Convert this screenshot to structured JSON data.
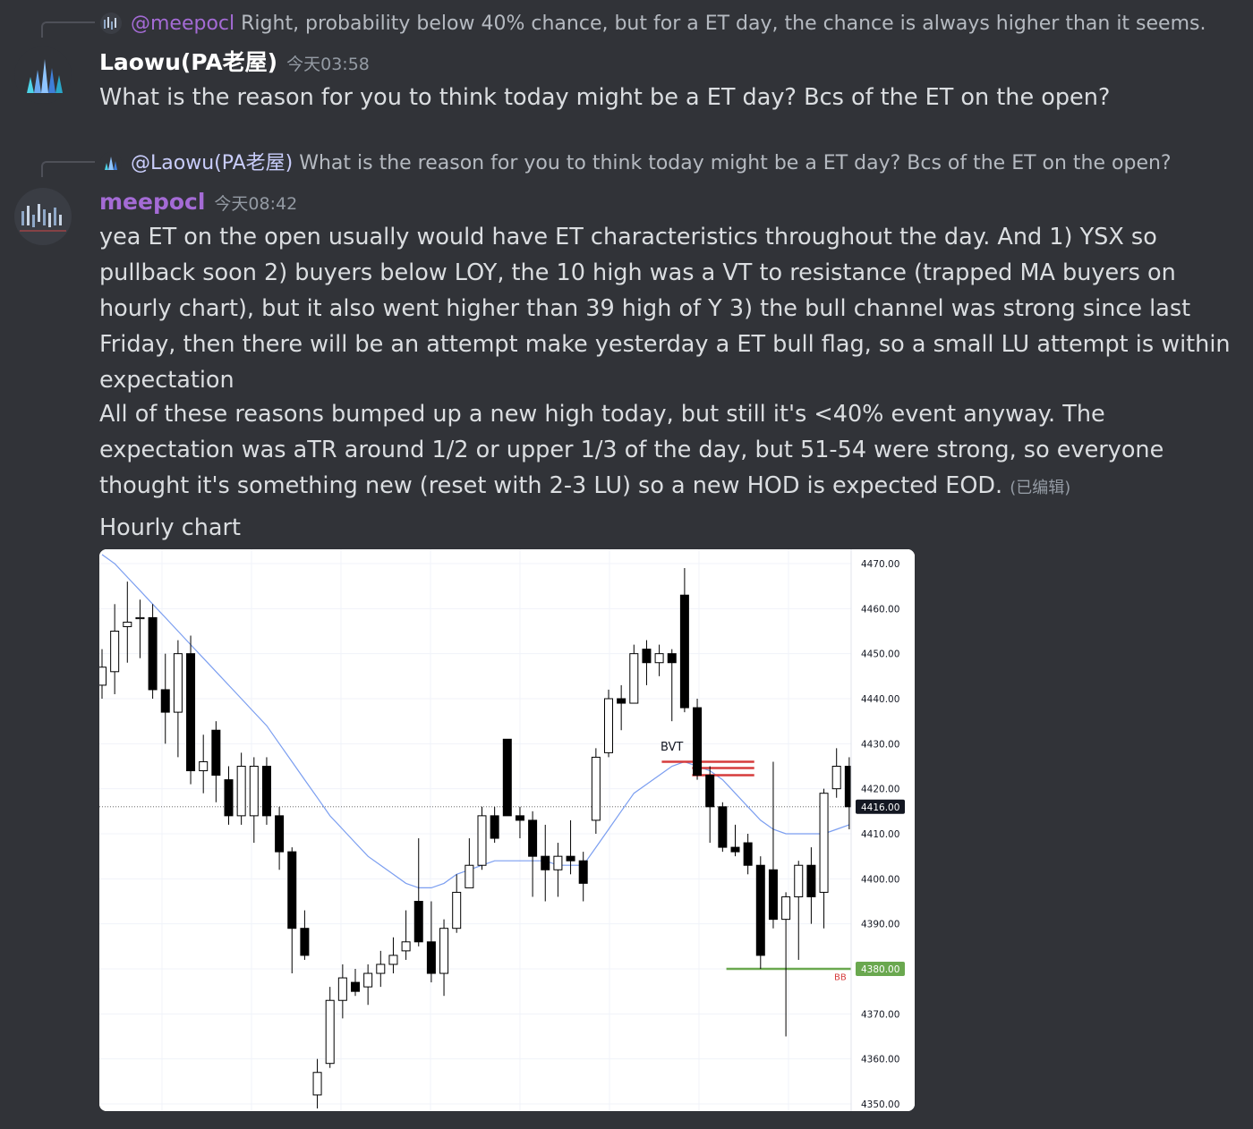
{
  "messages": [
    {
      "reply": {
        "mention": "@meepocl",
        "text": "Right, probability below 40% chance, but for a ET day, the chance is always higher than it seems."
      },
      "author": "Laowu(PA老屋)",
      "timestamp": "今天03:58",
      "content": "What is the reason for you to think today might be a ET day? Bcs of the ET on the open?"
    },
    {
      "reply": {
        "mention": "@Laowu(PA老屋)",
        "text": "What is the reason for you to think today might be a ET day? Bcs of the ET on the open?"
      },
      "author": "meepocl",
      "timestamp": "今天08:42",
      "paragraph1": "yea ET on the open usually would have ET characteristics throughout the day. And 1) YSX so pullback soon 2) buyers below LOY, the 10 high was a VT to resistance (trapped MA buyers on hourly chart),  but it also went higher than 39 high of Y 3) the bull channel was strong since last Friday, then there will be an attempt make yesterday a ET bull flag, so a small LU attempt is within expectation",
      "paragraph2": "All of these reasons bumped up a new high today, but still it's <40% event anyway. The expectation was aTR around 1/2 or upper 1/3 of the day, but 51-54 were strong, so everyone thought it's something new (reset with 2-3 LU) so a new HOD is expected EOD.",
      "edited": "(已编辑)",
      "attachment_title": "Hourly chart"
    }
  ],
  "colors": {
    "laowu_name": "#ffffff",
    "meepocl_name": "#a46bd5",
    "meepocl_mention": "#b98ce6",
    "laowu_mention": "#c9cdfb",
    "ma_line": "#7b9ef0",
    "resistance": "#d63c3c",
    "support": "#6aa84f"
  },
  "chart_data": {
    "type": "candlestick",
    "timeframe": "hourly",
    "y_ticks": [
      "4470.00",
      "4460.00",
      "4450.00",
      "4440.00",
      "4430.00",
      "4420.00",
      "4410.00",
      "4400.00",
      "4390.00",
      "4380.00",
      "4370.00",
      "4360.00",
      "4350.00"
    ],
    "ylim": [
      4347,
      4472
    ],
    "current_price_label": "4416.00",
    "current_price": 4416,
    "support_label": "4380.00",
    "support_price": 4380,
    "annotations": {
      "top_line": "BVT",
      "bottom_line": "BB"
    },
    "resistance_prices": [
      4426,
      4425,
      4424
    ],
    "candles": [
      {
        "o": 4443,
        "c": 4447,
        "h": 4451,
        "l": 4440
      },
      {
        "o": 4446,
        "c": 4455,
        "h": 4461,
        "l": 4441
      },
      {
        "o": 4456,
        "c": 4457,
        "h": 4466,
        "l": 4448
      },
      {
        "o": 4458,
        "c": 4458,
        "h": 4462,
        "l": 4449
      },
      {
        "o": 4458,
        "c": 4442,
        "h": 4461,
        "l": 4440
      },
      {
        "o": 4442,
        "c": 4437,
        "h": 4450,
        "l": 4430
      },
      {
        "o": 4437,
        "c": 4450,
        "h": 4453,
        "l": 4427
      },
      {
        "o": 4450,
        "c": 4424,
        "h": 4454,
        "l": 4421
      },
      {
        "o": 4424,
        "c": 4426,
        "h": 4432,
        "l": 4419
      },
      {
        "o": 4433,
        "c": 4423,
        "h": 4435,
        "l": 4417
      },
      {
        "o": 4422,
        "c": 4414,
        "h": 4425,
        "l": 4412
      },
      {
        "o": 4414,
        "c": 4425,
        "h": 4428,
        "l": 4412
      },
      {
        "o": 4414,
        "c": 4425,
        "h": 4427,
        "l": 4408
      },
      {
        "o": 4425,
        "c": 4414,
        "h": 4427,
        "l": 4412
      },
      {
        "o": 4414,
        "c": 4406,
        "h": 4416,
        "l": 4402
      },
      {
        "o": 4406,
        "c": 4389,
        "h": 4407,
        "l": 4379
      },
      {
        "o": 4389,
        "c": 4383,
        "h": 4393,
        "l": 4382
      },
      {
        "o": 4352,
        "c": 4357,
        "h": 4360,
        "l": 4349
      },
      {
        "o": 4359,
        "c": 4373,
        "h": 4376,
        "l": 4358
      },
      {
        "o": 4373,
        "c": 4378,
        "h": 4381,
        "l": 4369
      },
      {
        "o": 4377,
        "c": 4375,
        "h": 4380,
        "l": 4374
      },
      {
        "o": 4376,
        "c": 4379,
        "h": 4381,
        "l": 4372
      },
      {
        "o": 4379,
        "c": 4381,
        "h": 4384,
        "l": 4376
      },
      {
        "o": 4381,
        "c": 4383,
        "h": 4387,
        "l": 4379
      },
      {
        "o": 4384,
        "c": 4386,
        "h": 4393,
        "l": 4382
      },
      {
        "o": 4395,
        "c": 4386,
        "h": 4409,
        "l": 4385
      },
      {
        "o": 4386,
        "c": 4379,
        "h": 4395,
        "l": 4377
      },
      {
        "o": 4379,
        "c": 4389,
        "h": 4391,
        "l": 4374
      },
      {
        "o": 4389,
        "c": 4397,
        "h": 4401,
        "l": 4388
      },
      {
        "o": 4398,
        "c": 4403,
        "h": 4409,
        "l": 4398
      },
      {
        "o": 4403,
        "c": 4414,
        "h": 4416,
        "l": 4402
      },
      {
        "o": 4414,
        "c": 4409,
        "h": 4416,
        "l": 4408
      },
      {
        "o": 4431,
        "c": 4414,
        "h": 4431,
        "l": 4414
      },
      {
        "o": 4414,
        "c": 4413,
        "h": 4416,
        "l": 4409
      },
      {
        "o": 4413,
        "c": 4405,
        "h": 4415,
        "l": 4396
      },
      {
        "o": 4405,
        "c": 4402,
        "h": 4412,
        "l": 4395
      },
      {
        "o": 4402,
        "c": 4405,
        "h": 4408,
        "l": 4396
      },
      {
        "o": 4405,
        "c": 4404,
        "h": 4413,
        "l": 4401
      },
      {
        "o": 4404,
        "c": 4399,
        "h": 4406,
        "l": 4395
      },
      {
        "o": 4413,
        "c": 4427,
        "h": 4429,
        "l": 4410
      },
      {
        "o": 4428,
        "c": 4440,
        "h": 4442,
        "l": 4427
      },
      {
        "o": 4440,
        "c": 4439,
        "h": 4443,
        "l": 4433
      },
      {
        "o": 4439,
        "c": 4450,
        "h": 4452,
        "l": 4439
      },
      {
        "o": 4451,
        "c": 4448,
        "h": 4453,
        "l": 4443
      },
      {
        "o": 4448,
        "c": 4450,
        "h": 4452,
        "l": 4445
      },
      {
        "o": 4450,
        "c": 4448,
        "h": 4451,
        "l": 4435
      },
      {
        "o": 4463,
        "c": 4438,
        "h": 4469,
        "l": 4437
      },
      {
        "o": 4438,
        "c": 4423,
        "h": 4440,
        "l": 4422
      },
      {
        "o": 4423,
        "c": 4416,
        "h": 4425,
        "l": 4408
      },
      {
        "o": 4416,
        "c": 4407,
        "h": 4417,
        "l": 4406
      },
      {
        "o": 4407,
        "c": 4406,
        "h": 4412,
        "l": 4405
      },
      {
        "o": 4408,
        "c": 4403,
        "h": 4410,
        "l": 4401
      },
      {
        "o": 4403,
        "c": 4383,
        "h": 4405,
        "l": 4380
      },
      {
        "o": 4402,
        "c": 4391,
        "h": 4426,
        "l": 4389
      },
      {
        "o": 4391,
        "c": 4396,
        "h": 4397,
        "l": 4365
      },
      {
        "o": 4396,
        "c": 4403,
        "h": 4404,
        "l": 4382
      },
      {
        "o": 4403,
        "c": 4396,
        "h": 4407,
        "l": 4390
      },
      {
        "o": 4397,
        "c": 4419,
        "h": 4420,
        "l": 4389
      },
      {
        "o": 4420,
        "c": 4425,
        "h": 4429,
        "l": 4418
      },
      {
        "o": 4425,
        "c": 4416,
        "h": 4427,
        "l": 4411
      }
    ],
    "ma": [
      4472,
      4470,
      4467,
      4464,
      4461,
      4458,
      4455,
      4452,
      4449,
      4446,
      4443,
      4440,
      4437,
      4434,
      4430,
      4426,
      4422,
      4418,
      4414,
      4411,
      4408,
      4405,
      4403,
      4401,
      4399,
      4398,
      4398,
      4399,
      4401,
      4402,
      4403,
      4404,
      4404,
      4404,
      4404,
      4404,
      4403,
      4403,
      4403,
      4407,
      4411,
      4415,
      4419,
      4421,
      4423,
      4425,
      4426,
      4425,
      4424,
      4422,
      4419,
      4416,
      4413,
      4411,
      4410,
      4410,
      4410,
      4410,
      4411,
      4412
    ]
  }
}
